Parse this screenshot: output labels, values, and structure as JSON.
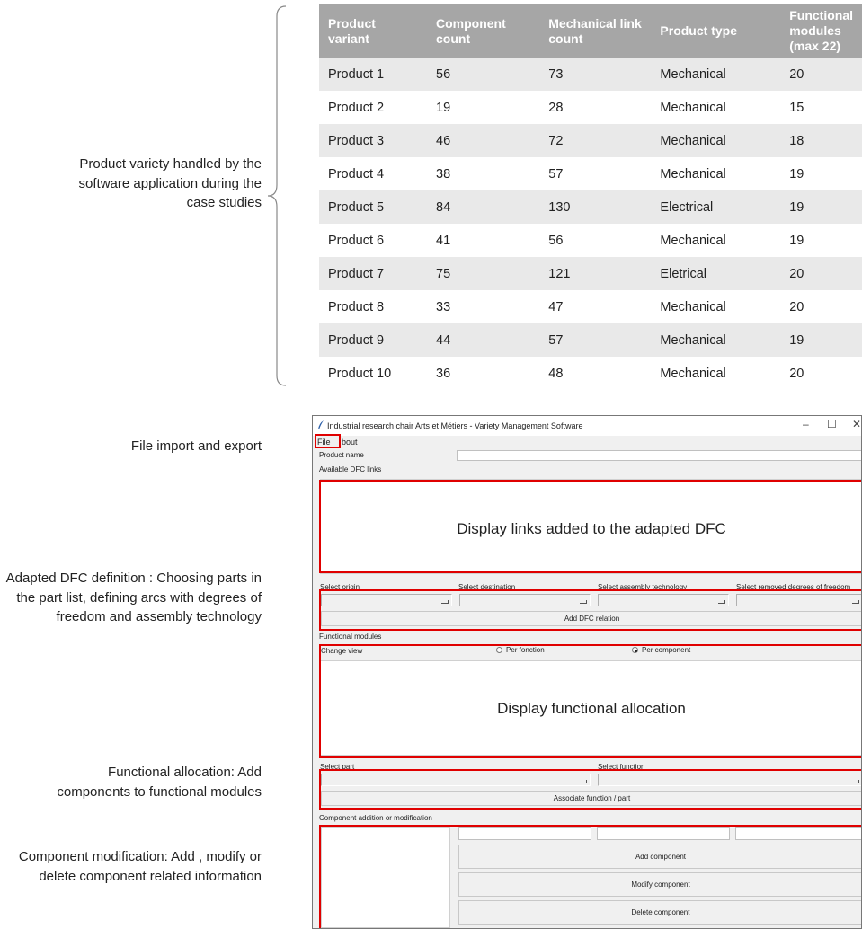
{
  "table": {
    "headers": [
      "Product variant",
      "Component count",
      "Mechanical link count",
      "Product type",
      "Functional modules (max 22)"
    ],
    "rows": [
      [
        "Product 1",
        "56",
        "73",
        "Mechanical",
        "20"
      ],
      [
        "Product 2",
        "19",
        "28",
        "Mechanical",
        "15"
      ],
      [
        "Product 3",
        "46",
        "72",
        "Mechanical",
        "18"
      ],
      [
        "Product 4",
        "38",
        "57",
        "Mechanical",
        "19"
      ],
      [
        "Product 5",
        "84",
        "130",
        "Electrical",
        "19"
      ],
      [
        "Product 6",
        "41",
        "56",
        "Mechanical",
        "19"
      ],
      [
        "Product 7",
        "75",
        "121",
        "Eletrical",
        "20"
      ],
      [
        "Product 8",
        "33",
        "47",
        "Mechanical",
        "20"
      ],
      [
        "Product 9",
        "44",
        "57",
        "Mechanical",
        "19"
      ],
      [
        "Product 10",
        "36",
        "48",
        "Mechanical",
        "20"
      ]
    ]
  },
  "annotations": {
    "variety": "Product variety handled by the software application during the case studies",
    "file": "File import and export",
    "dfc": "Adapted DFC definition : Choosing parts in the part list, defining arcs with degrees of freedom and assembly technology",
    "allocation": "Functional allocation: Add components to functional modules",
    "component": "Component modification: Add , modify or delete component related information"
  },
  "window": {
    "title": "Industrial research chair Arts et Métiers - Variety Management Software",
    "controls": {
      "minimize": "–",
      "maximize": "☐",
      "close": "✕"
    },
    "menu": {
      "file": "File",
      "about": "bout"
    },
    "product_name_label": "Product name",
    "available_links_label": "Available DFC links",
    "links_placeholder": "Display links added to the adapted DFC",
    "select_origin": "Select origin",
    "select_destination": "Select destination",
    "select_assembly": "Select assembly technology",
    "select_removed_dof": "Select removed degrees of freedom",
    "add_dfc_button": "Add DFC relation",
    "functional_modules_label": "Functional modules",
    "change_view_label": "Change view",
    "radio_per_function": "Per fonction",
    "radio_per_component": "Per component",
    "radio_selected": "per_component",
    "allocation_placeholder": "Display functional allocation",
    "select_part": "Select part",
    "select_function": "Select function",
    "associate_button": "Associate function / part",
    "component_section_label": "Component addition or modification",
    "add_component_button": "Add component",
    "modify_component_button": "Modify component",
    "delete_component_button": "Delete component"
  },
  "colors": {
    "highlight": "#e00000",
    "table_header": "#a6a6a6",
    "row_stripe": "#e9e9e9",
    "arrow": "#c0c0c0"
  }
}
